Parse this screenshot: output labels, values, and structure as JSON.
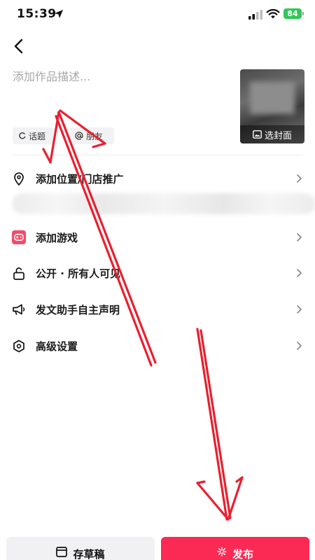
{
  "status_bar": {
    "time": "15:39",
    "battery": "84",
    "icons": [
      "location-arrow-icon",
      "cellular-signal-icon",
      "wifi-icon",
      "battery-icon"
    ],
    "battery_color": "#31c759"
  },
  "header": {
    "back_icon": "chevron-left-icon"
  },
  "description": {
    "placeholder": "添加作品描述...",
    "value": ""
  },
  "cover": {
    "label": "选封面",
    "icon": "image-icon"
  },
  "chips": [
    {
      "label": "话题",
      "icon": "hashtag-ring-icon"
    },
    {
      "label": "朋友",
      "icon": "at-icon"
    }
  ],
  "settings": [
    {
      "label": "添加位置/门店推广",
      "icon": "location-pin-icon"
    },
    {
      "label": "添加游戏",
      "icon": "gamepad-icon"
    },
    {
      "label": "公开 · 所有人可见",
      "icon": "unlock-icon"
    },
    {
      "label": "发文助手自主声明",
      "icon": "megaphone-icon"
    },
    {
      "label": "高级设置",
      "icon": "hexagon-settings-icon"
    }
  ],
  "bottom": {
    "draft_label": "存草稿",
    "publish_label": "发布",
    "draft_icon": "draft-box-icon",
    "publish_icon": "sparkle-icon"
  },
  "colors": {
    "accent": "#fa2a55",
    "game_icon": "#f24c6a",
    "annotation_arrow": "#e8202f"
  }
}
